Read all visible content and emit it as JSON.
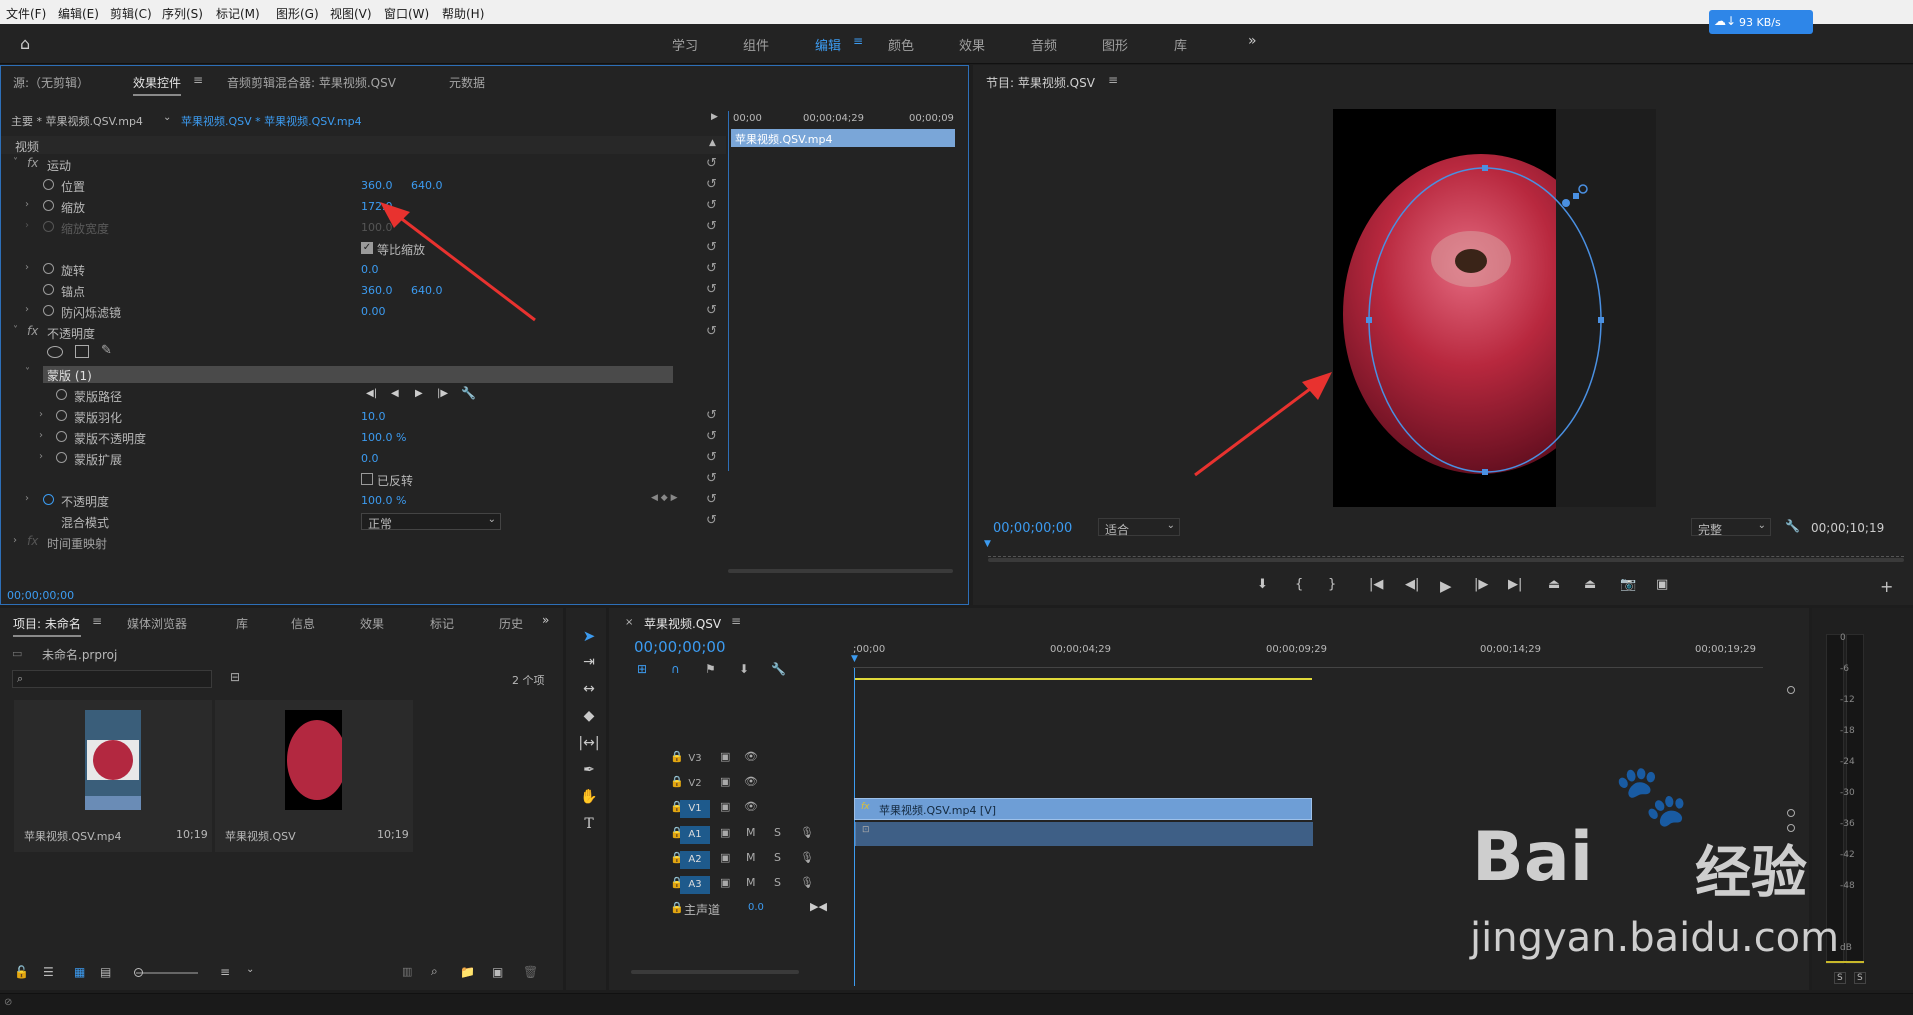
{
  "menu": [
    "文件(F)",
    "编辑(E)",
    "剪辑(C)",
    "序列(S)",
    "标记(M)",
    "图形(G)",
    "视图(V)",
    "窗口(W)",
    "帮助(H)"
  ],
  "workspaces": [
    "学习",
    "组件",
    "编辑",
    "颜色",
    "效果",
    "音频",
    "图形",
    "库"
  ],
  "net": {
    "speed": "93 KB/s"
  },
  "effects_tabs": [
    "源:（无剪辑）",
    "效果控件",
    "音频剪辑混合器: 苹果视频.QSV",
    "元数据"
  ],
  "effects": {
    "master": "主要 * 苹果视频.QSV.mp4",
    "seq": "苹果视频.QSV * 苹果视频.QSV.mp4",
    "ruler": [
      "00;00",
      "00;00;04;29",
      "00;00;09"
    ],
    "clip": "苹果视频.QSV.mp4",
    "video": "视频",
    "motion": "运动",
    "position": "位置",
    "pos_x": "360.0",
    "pos_y": "640.0",
    "scale": "缩放",
    "scale_v": "172.0",
    "scale_w": "缩放宽度",
    "scale_w_v": "100.0",
    "uniform": "等比缩放",
    "rotation": "旋转",
    "rotation_v": "0.0",
    "anchor": "锚点",
    "anchor_x": "360.0",
    "anchor_y": "640.0",
    "flicker": "防闪烁滤镜",
    "flicker_v": "0.00",
    "opacity_grp": "不透明度",
    "mask": "蒙版 (1)",
    "mask_path": "蒙版路径",
    "mask_feather": "蒙版羽化",
    "mask_feather_v": "10.0",
    "mask_opacity": "蒙版不透明度",
    "mask_opacity_v": "100.0 %",
    "mask_expand": "蒙版扩展",
    "mask_expand_v": "0.0",
    "inverted": "已反转",
    "opacity": "不透明度",
    "opacity_v": "100.0 %",
    "blend": "混合模式",
    "blend_v": "正常",
    "timeremap": "时间重映射",
    "time": "00;00;00;00"
  },
  "program": {
    "title": "节目: 苹果视频.QSV",
    "time": "00;00;00;00",
    "fit": "适合",
    "quality": "完整",
    "duration": "00;00;10;19"
  },
  "project": {
    "tabs": [
      "项目: 未命名",
      "媒体浏览器",
      "库",
      "信息",
      "效果",
      "标记",
      "历史"
    ],
    "file": "未命名.prproj",
    "count": "2 个项",
    "items": [
      {
        "name": "苹果视频.QSV.mp4",
        "dur": "10;19"
      },
      {
        "name": "苹果视频.QSV",
        "dur": "10;19"
      }
    ]
  },
  "timeline": {
    "title": "苹果视频.QSV",
    "time": "00;00;00;00",
    "ruler": [
      ";00;00",
      "00;00;04;29",
      "00;00;09;29",
      "00;00;14;29",
      "00;00;19;29"
    ],
    "tracks": [
      "V3",
      "V2",
      "V1",
      "A1",
      "A2",
      "A3"
    ],
    "master": "主声道",
    "master_v": "0.0",
    "clip": "苹果视频.QSV.mp4 [V]",
    "solo": [
      "M",
      "S"
    ]
  },
  "meter": [
    "0",
    "-6",
    "-12",
    "-18",
    "-24",
    "-30",
    "-36",
    "-42",
    "-48",
    "dB"
  ],
  "watermark": {
    "line1": "Bai",
    "line2": "经验",
    "url": "jingyan.baidu.com"
  }
}
